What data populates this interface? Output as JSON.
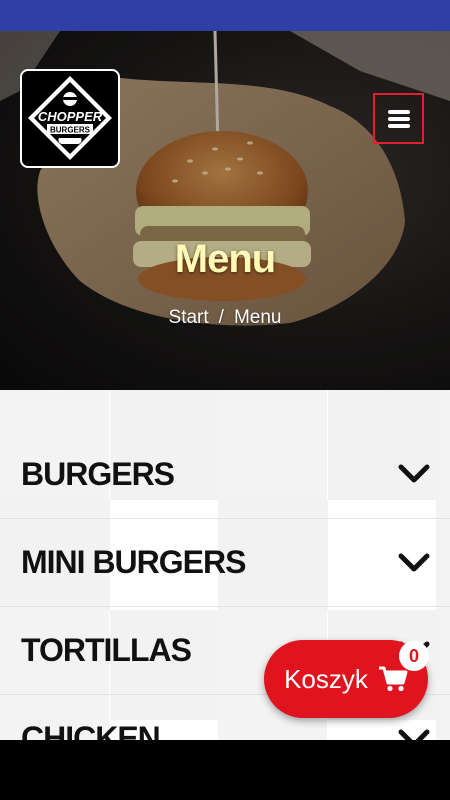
{
  "brand": {
    "logo_top": "CHOPPER",
    "logo_bottom": "BURGERS"
  },
  "hero": {
    "title": "Menu",
    "breadcrumb": {
      "home": "Start",
      "separator": "/",
      "current": "Menu"
    }
  },
  "categories": [
    {
      "label": "BURGERS"
    },
    {
      "label": "MINI BURGERS"
    },
    {
      "label": "TORTILLAS"
    },
    {
      "label": "CHICKEN"
    }
  ],
  "cart": {
    "label": "Koszyk",
    "count": "0"
  },
  "colors": {
    "accent": "#e0141f",
    "status_bar": "#2f3fa6",
    "title": "#fff9b6"
  },
  "icons": {
    "menu": "hamburger-icon",
    "cart": "cart-icon",
    "expand": "chevron-down-icon"
  }
}
